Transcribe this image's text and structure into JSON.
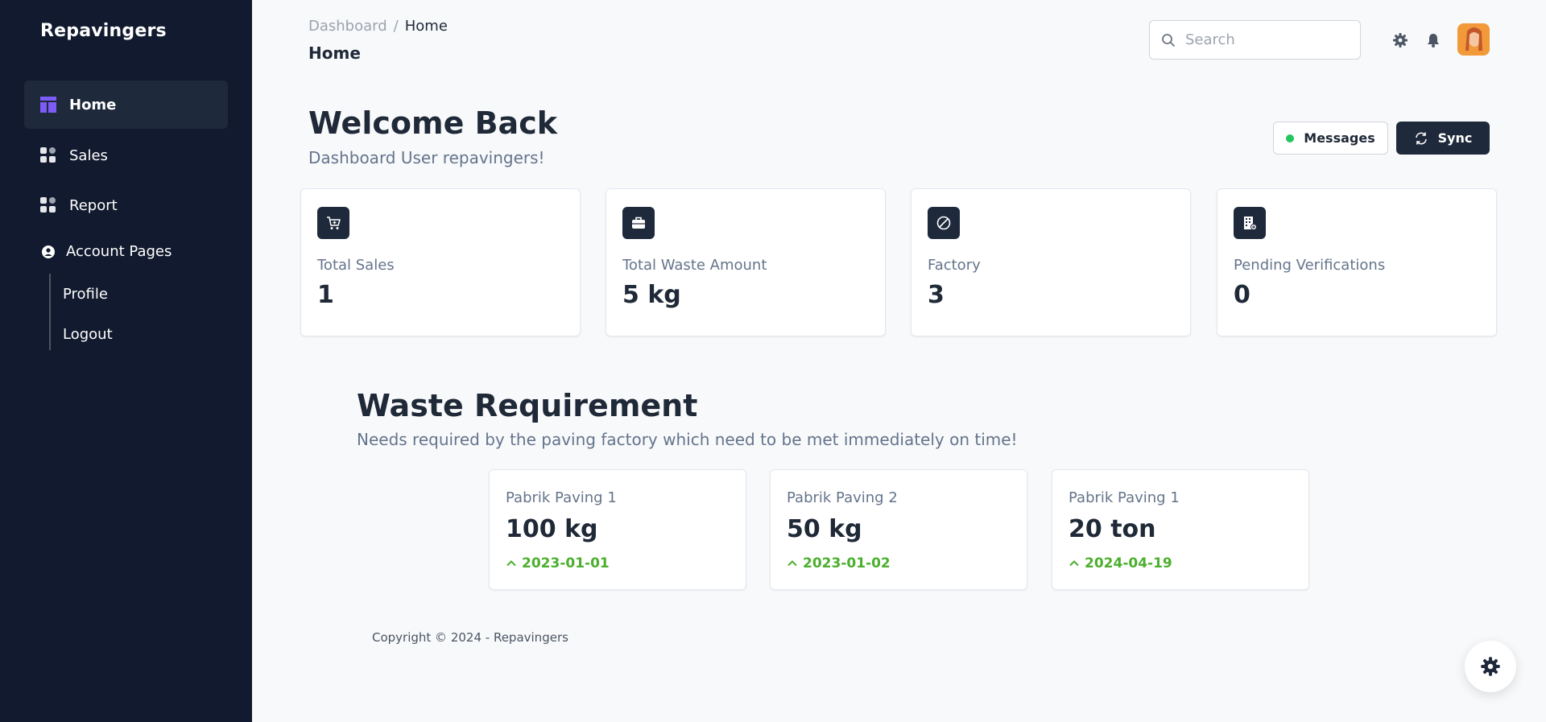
{
  "sidebar": {
    "brand": "Repavingers",
    "items": [
      {
        "label": "Home",
        "icon": "dashboard-icon"
      },
      {
        "label": "Sales",
        "icon": "apps-icon"
      },
      {
        "label": "Report",
        "icon": "apps-icon"
      }
    ],
    "account_section": "Account Pages",
    "account_items": [
      {
        "label": "Profile"
      },
      {
        "label": "Logout"
      }
    ]
  },
  "header": {
    "breadcrumb_parent": "Dashboard",
    "breadcrumb_separator": "/",
    "breadcrumb_current": "Home",
    "page_title": "Home",
    "search_placeholder": "Search"
  },
  "welcome": {
    "title": "Welcome Back",
    "subtitle": "Dashboard User repavingers!",
    "messages_label": "Messages",
    "sync_label": "Sync"
  },
  "stats": [
    {
      "label": "Total Sales",
      "value": "1",
      "icon": "cart-icon"
    },
    {
      "label": "Total Waste Amount",
      "value": "5 kg",
      "icon": "briefcase-icon"
    },
    {
      "label": "Factory",
      "value": "3",
      "icon": "ban-icon"
    },
    {
      "label": "Pending Verifications",
      "value": "0",
      "icon": "building-icon"
    }
  ],
  "requirements": {
    "title": "Waste Requirement",
    "subtitle": "Needs required by the paving factory which need to be met immediately on time!",
    "items": [
      {
        "name": "Pabrik Paving 1",
        "amount": "100 kg",
        "date": "2023-01-01"
      },
      {
        "name": "Pabrik Paving 2",
        "amount": "50 kg",
        "date": "2023-01-02"
      },
      {
        "name": "Pabrik Paving 1",
        "amount": "20 ton",
        "date": "2024-04-19"
      }
    ]
  },
  "footer": {
    "copyright": "Copyright © 2024 - Repavingers"
  },
  "colors": {
    "sidebar_bg": "#111a2e",
    "accent": "#1e293b",
    "status_green": "#22c55e",
    "date_green": "#4caf2e",
    "home_icon": "#7c5cf5"
  }
}
